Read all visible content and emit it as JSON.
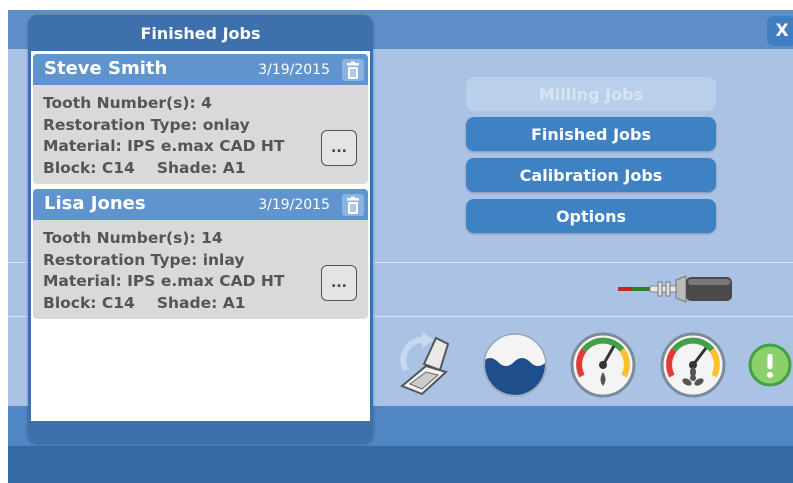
{
  "window": {
    "close_label": "X"
  },
  "menu": {
    "milling_label": "Milling Jobs",
    "finished_label": "Finished Jobs",
    "calibration_label": "Calibration Jobs",
    "options_label": "Options"
  },
  "status_icons": [
    "tool-icon",
    "door-open-icon",
    "water-level-icon",
    "pressure-gauge-icon",
    "fan-gauge-icon",
    "alert-icon"
  ],
  "panel": {
    "title": "Finished Jobs",
    "jobs": [
      {
        "name": "Steve Smith",
        "date": "3/19/2015",
        "tooth_label": "Tooth Number(s):",
        "tooth_value": "4",
        "type_label": "Restoration Type:",
        "type_value": "onlay",
        "material_label": "Material:",
        "material_value": "IPS e.max CAD HT",
        "block_label": "Block:",
        "block_value": "C14",
        "shade_label": "Shade:",
        "shade_value": "A1",
        "more_label": "..."
      },
      {
        "name": "Lisa Jones",
        "date": "3/19/2015",
        "tooth_label": "Tooth Number(s):",
        "tooth_value": "14",
        "type_label": "Restoration Type:",
        "type_value": "inlay",
        "material_label": "Material:",
        "material_value": "IPS e.max CAD HT",
        "block_label": "Block:",
        "block_value": "C14",
        "shade_label": "Shade:",
        "shade_value": "A1",
        "more_label": "..."
      }
    ]
  },
  "colors": {
    "background": "#aac3e4",
    "topbar": "#5d8ec7",
    "button": "#3f82c4",
    "panel": "#3d70ac",
    "job_header": "#5f94cf",
    "job_body": "#d9d9d9"
  }
}
